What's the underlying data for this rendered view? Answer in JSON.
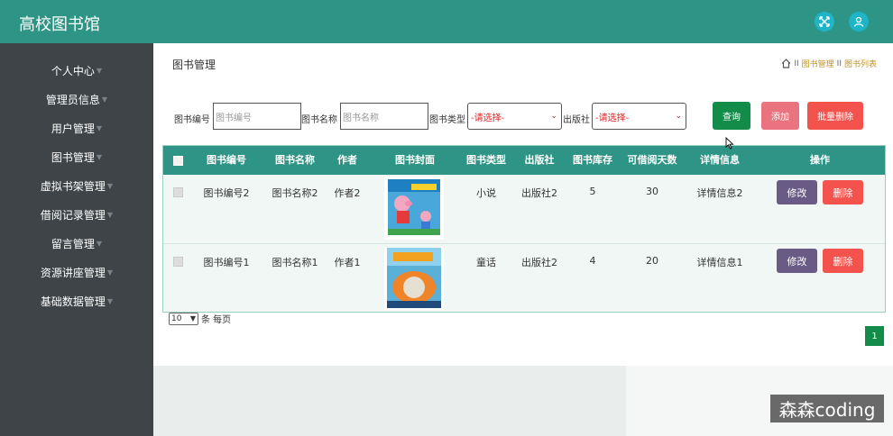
{
  "header": {
    "title": "高校图书馆",
    "expand_icon": "expand-icon",
    "user_icon": "user-icon"
  },
  "sidebar": {
    "items": [
      {
        "label": "个人中心"
      },
      {
        "label": "管理员信息"
      },
      {
        "label": "用户管理"
      },
      {
        "label": "图书管理"
      },
      {
        "label": "虚拟书架管理"
      },
      {
        "label": "借阅记录管理"
      },
      {
        "label": "留言管理"
      },
      {
        "label": "资源讲座管理"
      },
      {
        "label": "基础数据管理"
      }
    ]
  },
  "page": {
    "title": "图书管理"
  },
  "breadcrumb": {
    "sep": "II",
    "items": [
      "图书管理",
      "图书列表"
    ]
  },
  "search": {
    "code_label": "图书编号",
    "code_placeholder": "图书编号",
    "name_label": "图书名称",
    "name_placeholder": "图书名称",
    "type_label": "图书类型",
    "type_selected": "-请选择-",
    "publisher_label": "出版社",
    "publisher_selected": "-请选择-"
  },
  "toolbar": {
    "query": "查询",
    "add": "添加",
    "batch_delete": "批量删除"
  },
  "table": {
    "headers": [
      "图书编号",
      "图书名称",
      "作者",
      "图书封面",
      "图书类型",
      "出版社",
      "图书库存",
      "可借阅天数",
      "详情信息",
      "操作"
    ],
    "rows": [
      {
        "code": "图书编号2",
        "name": "图书名称2",
        "author": "作者2",
        "cover": "peppa-pig-book-cover",
        "type": "小说",
        "publisher": "出版社2",
        "stock": "5",
        "days": "30",
        "detail": "详情信息2",
        "edit": "修改",
        "delete": "删除"
      },
      {
        "code": "图书编号1",
        "name": "图书名称1",
        "author": "作者1",
        "cover": "pumpkin-house-book-cover",
        "type": "童话",
        "publisher": "出版社2",
        "stock": "4",
        "days": "20",
        "detail": "详情信息1",
        "edit": "修改",
        "delete": "删除"
      }
    ]
  },
  "pagination": {
    "page_size": "10",
    "per_page_label": "条 每页",
    "current_page": "1"
  },
  "watermark": "森森coding",
  "colors": {
    "primary": "#2e9485",
    "sidebar": "#3e4448",
    "query": "#148c49",
    "add": "#e9747f",
    "danger": "#f4524c",
    "edit": "#6a5b86"
  }
}
